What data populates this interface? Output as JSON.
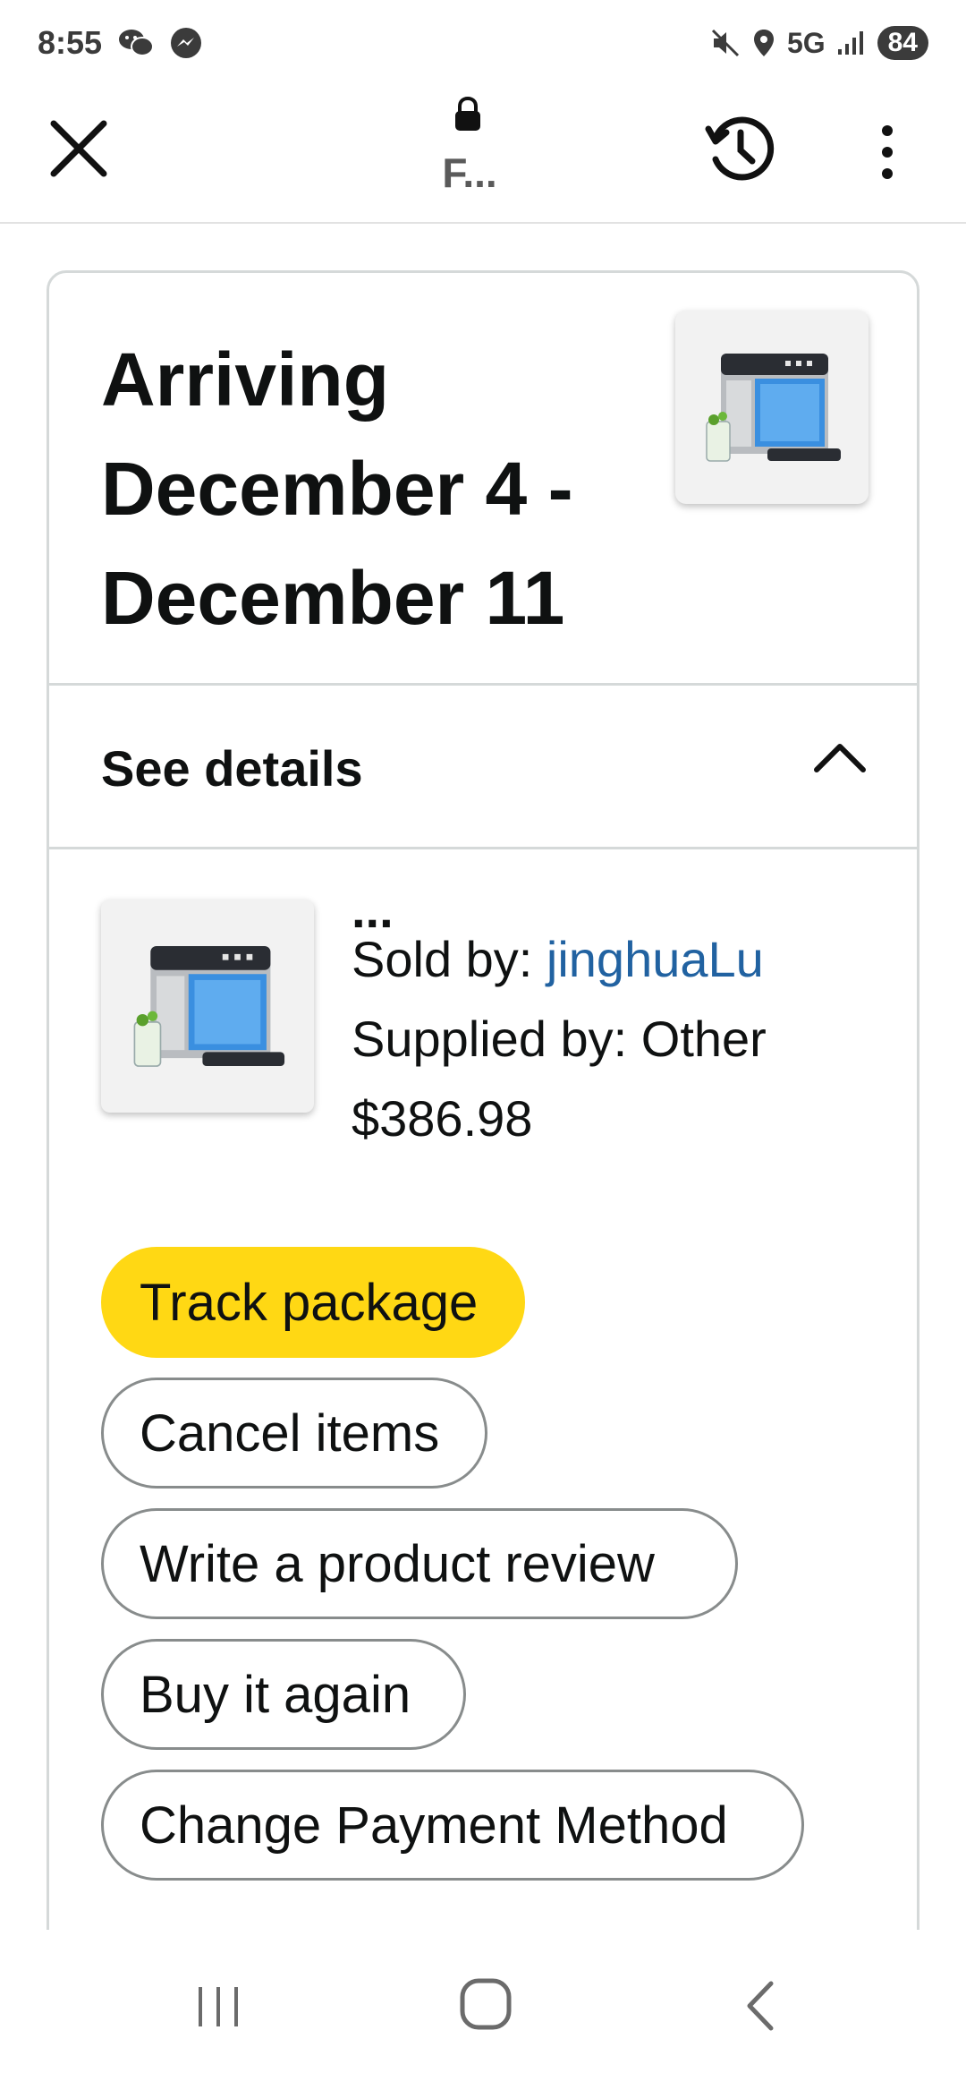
{
  "status_bar": {
    "time": "8:55",
    "network": "5G",
    "battery": "84",
    "icons": [
      "wechat-icon",
      "messenger-icon",
      "mute-icon",
      "location-icon",
      "signal-icon"
    ]
  },
  "browser": {
    "title": "F...",
    "icons": [
      "close-icon",
      "lock-icon",
      "history-icon",
      "more-vertical-icon"
    ]
  },
  "order": {
    "arrival_line1": "Arriving",
    "arrival_line2": "December 4 -",
    "arrival_line3": "December 11",
    "details_label": "See details",
    "item": {
      "title_truncated": "...",
      "sold_by_prefix": "Sold by: ",
      "seller": "jinghuaLu",
      "supplied_by": "Supplied by: Other",
      "price": "$386.98"
    },
    "buttons": {
      "track": "Track package",
      "cancel": "Cancel items",
      "review": "Write a product review",
      "again": "Buy it again",
      "payment": "Change Payment Method"
    }
  },
  "colors": {
    "primary_button": "#ffd814",
    "link": "#2162a1",
    "border": "#d5d9d9",
    "text": "#0f1111"
  },
  "nav_bar": {
    "icons": [
      "recents-icon",
      "home-icon",
      "back-icon"
    ]
  }
}
